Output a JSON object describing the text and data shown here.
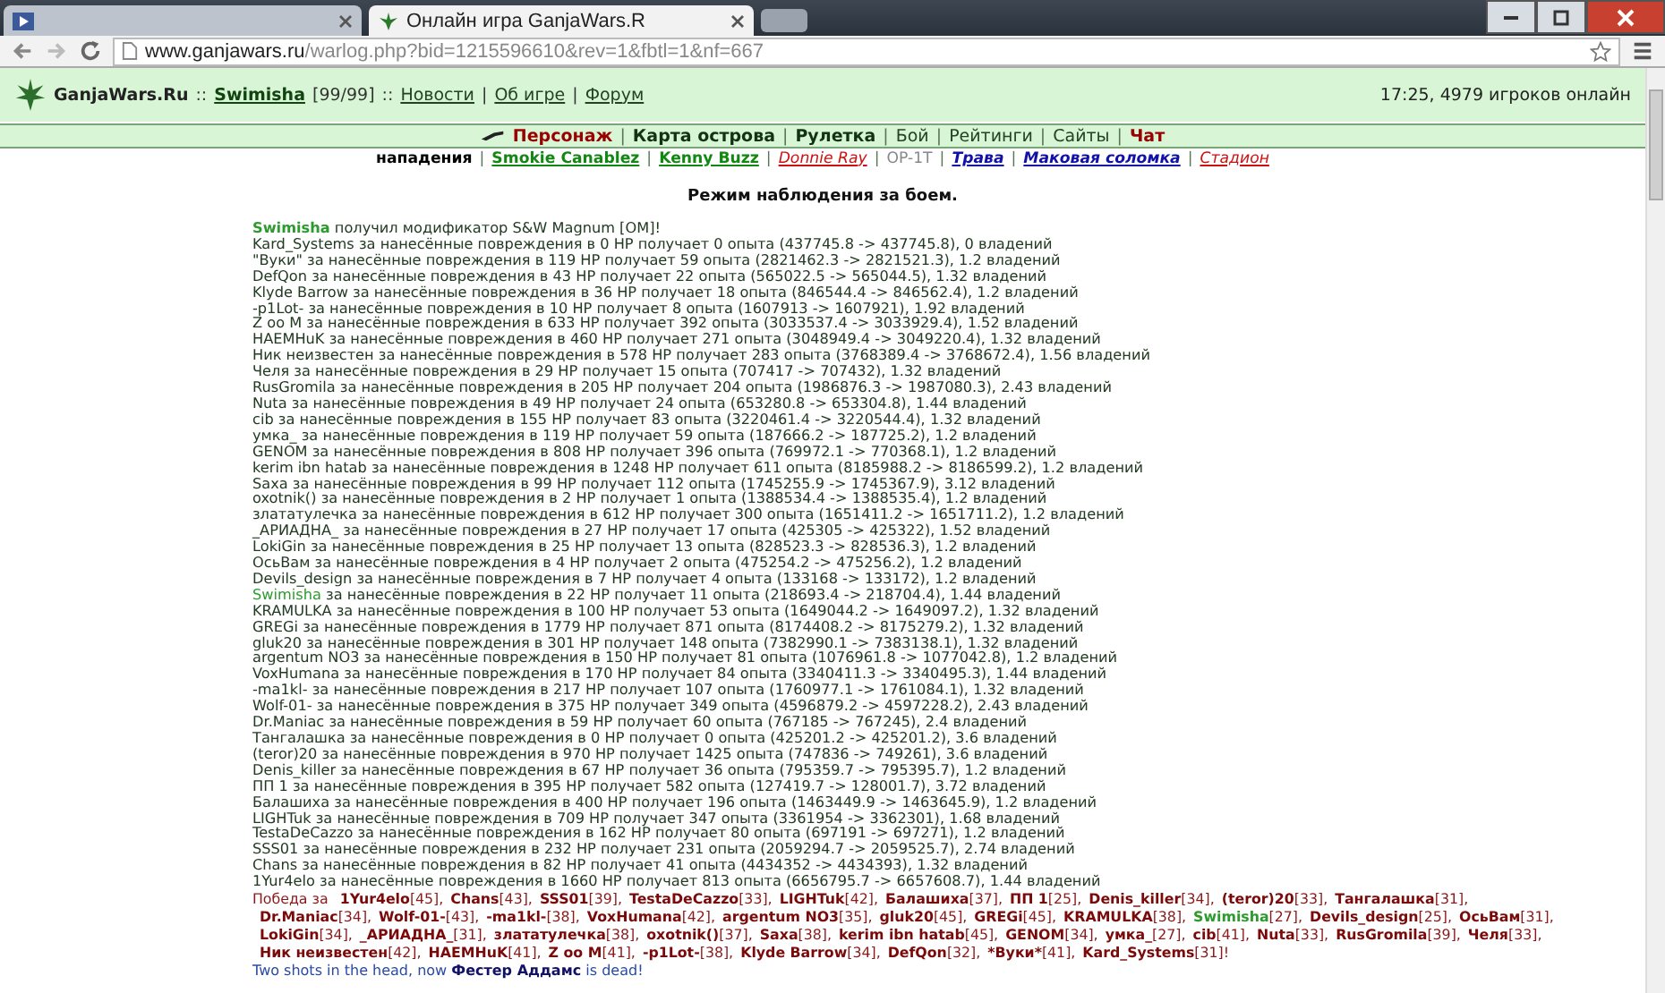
{
  "browser": {
    "tabs": [
      {
        "selected": false
      },
      {
        "title": "Онлайн игра GanjaWars.R",
        "selected": true
      }
    ],
    "url_host": "www.ganjawars.ru",
    "url_path": "/warlog.php?bid=1215596610&rev=1&fbtl=1&nf=667"
  },
  "header": {
    "site": "GanjaWars.Ru",
    "sep": "::",
    "user": "Swimisha",
    "hp": "[99/99]",
    "links": [
      "Новости",
      "Об игре",
      "Форум"
    ],
    "divider": "|",
    "status": "17:25, 4979 игроков онлайн"
  },
  "nav": {
    "divider": "|",
    "items": [
      {
        "label": "Персонаж",
        "kind": "main"
      },
      {
        "label": "Карта острова",
        "kind": "section"
      },
      {
        "label": "Рулетка",
        "kind": "section"
      },
      {
        "label": "Бой",
        "kind": "other"
      },
      {
        "label": "Рейтинги",
        "kind": "other"
      },
      {
        "label": "Сайты",
        "kind": "other"
      },
      {
        "label": "Чат",
        "kind": "main"
      }
    ]
  },
  "subnav": {
    "divider": "|",
    "items": [
      {
        "label": "нападения",
        "color": "#000000",
        "bold": true,
        "italic": false,
        "underline": false
      },
      {
        "label": "Smokie Canablez",
        "color": "#118811",
        "bold": true,
        "italic": false,
        "underline": true
      },
      {
        "label": "Kenny Buzz",
        "color": "#118811",
        "bold": true,
        "italic": false,
        "underline": true
      },
      {
        "label": "Donnie Ray",
        "color": "#cc1111",
        "bold": false,
        "italic": true,
        "underline": true
      },
      {
        "label": "OP-1T",
        "color": "#888888",
        "bold": false,
        "italic": false,
        "underline": false
      },
      {
        "label": "Трава",
        "color": "#1111aa",
        "bold": true,
        "italic": true,
        "underline": true
      },
      {
        "label": "Маковая соломка",
        "color": "#1111aa",
        "bold": true,
        "italic": true,
        "underline": true
      },
      {
        "label": "Стадион",
        "color": "#cc1111",
        "bold": false,
        "italic": true,
        "underline": true
      }
    ]
  },
  "title": "Режим наблюдения за боем.",
  "log": [
    {
      "name": "Swimisha",
      "text": "получил модификатор S&W Magnum [OM]!",
      "self": true,
      "kind": "event"
    },
    {
      "name": "Kard_Systems",
      "text": "за нанесённые повреждения в 0 HP получает 0 опыта (437745.8 -> 437745.8), 0 владений",
      "self": false,
      "kind": "damage"
    },
    {
      "name": "\"Вуки\"",
      "text": "за нанесённые повреждения в 119 HP получает 59 опыта (2821462.3 -> 2821521.3), 1.2 владений",
      "self": false,
      "kind": "damage"
    },
    {
      "name": "DefQon",
      "text": "за нанесённые повреждения в 43 HP получает 22 опыта (565022.5 -> 565044.5), 1.32 владений",
      "self": false,
      "kind": "damage"
    },
    {
      "name": "Klyde Barrow",
      "text": "за нанесённые повреждения в 36 HP получает 18 опыта (846544.4 -> 846562.4), 1.2 владений",
      "self": false,
      "kind": "damage"
    },
    {
      "name": "-p1Lot-",
      "text": "за нанесённые повреждения в 10 HP получает 8 опыта (1607913 -> 1607921), 1.92 владений",
      "self": false,
      "kind": "damage"
    },
    {
      "name": "Z oo M",
      "text": "за нанесённые повреждения в 633 HP получает 392 опыта (3033537.4 -> 3033929.4), 1.52 владений",
      "self": false,
      "kind": "damage"
    },
    {
      "name": "HAEMHuK",
      "text": "за нанесённые повреждения в 460 HP получает 271 опыта (3048949.4 -> 3049220.4), 1.32 владений",
      "self": false,
      "kind": "damage"
    },
    {
      "name": "Ник неизвестен",
      "text": "за нанесённые повреждения в 578 HP получает 283 опыта (3768389.4 -> 3768672.4), 1.56 владений",
      "self": false,
      "kind": "damage"
    },
    {
      "name": "Челя",
      "text": "за нанесённые повреждения в 29 HP получает 15 опыта (707417 -> 707432), 1.32 владений",
      "self": false,
      "kind": "damage"
    },
    {
      "name": "RusGromila",
      "text": "за нанесённые повреждения в 205 HP получает 204 опыта (1986876.3 -> 1987080.3), 2.43 владений",
      "self": false,
      "kind": "damage"
    },
    {
      "name": "Nuta",
      "text": "за нанесённые повреждения в 49 HP получает 24 опыта (653280.8 -> 653304.8), 1.44 владений",
      "self": false,
      "kind": "damage"
    },
    {
      "name": "cib",
      "text": "за нанесённые повреждения в 155 HP получает 83 опыта (3220461.4 -> 3220544.4), 1.32 владений",
      "self": false,
      "kind": "damage"
    },
    {
      "name": "умка_",
      "text": "за нанесённые повреждения в 119 HP получает 59 опыта (187666.2 -> 187725.2), 1.2 владений",
      "self": false,
      "kind": "damage"
    },
    {
      "name": "GENOM",
      "text": "за нанесённые повреждения в 808 HP получает 396 опыта (769972.1 -> 770368.1), 1.2 владений",
      "self": false,
      "kind": "damage"
    },
    {
      "name": "kerim ibn hatab",
      "text": "за нанесённые повреждения в 1248 HP получает 611 опыта (8185988.2 -> 8186599.2), 1.2 владений",
      "self": false,
      "kind": "damage"
    },
    {
      "name": "Saxa",
      "text": "за нанесённые повреждения в 99 HP получает 112 опыта (1745255.9 -> 1745367.9), 3.12 владений",
      "self": false,
      "kind": "damage"
    },
    {
      "name": "oxotnik()",
      "text": "за нанесённые повреждения в 2 HP получает 1 опыта (1388534.4 -> 1388535.4), 1.2 владений",
      "self": false,
      "kind": "damage"
    },
    {
      "name": "злататулечка",
      "text": "за нанесённые повреждения в 612 HP получает 300 опыта (1651411.2 -> 1651711.2), 1.2 владений",
      "self": false,
      "kind": "damage"
    },
    {
      "name": "_АРИАДНА_",
      "text": "за нанесённые повреждения в 27 HP получает 17 опыта (425305 -> 425322), 1.52 владений",
      "self": false,
      "kind": "damage"
    },
    {
      "name": "LokiGin",
      "text": "за нанесённые повреждения в 25 HP получает 13 опыта (828523.3 -> 828536.3), 1.2 владений",
      "self": false,
      "kind": "damage"
    },
    {
      "name": "ОсьВам",
      "text": "за нанесённые повреждения в 4 HP получает 2 опыта (475254.2 -> 475256.2), 1.2 владений",
      "self": false,
      "kind": "damage"
    },
    {
      "name": "Devils_design",
      "text": "за нанесённые повреждения в 7 HP получает 4 опыта (133168 -> 133172), 1.2 владений",
      "self": false,
      "kind": "damage"
    },
    {
      "name": "Swimisha",
      "text": "за нанесённые повреждения в 22 HP получает 11 опыта (218693.4 -> 218704.4), 1.44 владений",
      "self": true,
      "kind": "damage"
    },
    {
      "name": "KRAMULKA",
      "text": "за нанесённые повреждения в 100 HP получает 53 опыта (1649044.2 -> 1649097.2), 1.32 владений",
      "self": false,
      "kind": "damage"
    },
    {
      "name": "GREGi",
      "text": "за нанесённые повреждения в 1779 HP получает 871 опыта (8174408.2 -> 8175279.2), 1.32 владений",
      "self": false,
      "kind": "damage"
    },
    {
      "name": "gluk20",
      "text": "за нанесённые повреждения в 301 HP получает 148 опыта (7382990.1 -> 7383138.1), 1.32 владений",
      "self": false,
      "kind": "damage"
    },
    {
      "name": "argentum NO3",
      "text": "за нанесённые повреждения в 150 HP получает 81 опыта (1076961.8 -> 1077042.8), 1.2 владений",
      "self": false,
      "kind": "damage"
    },
    {
      "name": "VoxHumana",
      "text": "за нанесённые повреждения в 170 HP получает 84 опыта (3340411.3 -> 3340495.3), 1.44 владений",
      "self": false,
      "kind": "damage"
    },
    {
      "name": "-ma1kl-",
      "text": "за нанесённые повреждения в 217 HP получает 107 опыта (1760977.1 -> 1761084.1), 1.32 владений",
      "self": false,
      "kind": "damage"
    },
    {
      "name": "Wolf-01-",
      "text": "за нанесённые повреждения в 375 HP получает 349 опыта (4596879.2 -> 4597228.2), 2.43 владений",
      "self": false,
      "kind": "damage"
    },
    {
      "name": "Dr.Maniac",
      "text": "за нанесённые повреждения в 59 HP получает 60 опыта (767185 -> 767245), 2.4 владений",
      "self": false,
      "kind": "damage"
    },
    {
      "name": "Тангалашка",
      "text": "за нанесённые повреждения в 0 HP получает 0 опыта (425201.2 -> 425201.2), 3.6 владений",
      "self": false,
      "kind": "damage"
    },
    {
      "name": "(teror)20",
      "text": "за нанесённые повреждения в 970 HP получает 1425 опыта (747836 -> 749261), 3.6 владений",
      "self": false,
      "kind": "damage"
    },
    {
      "name": "Denis_killer",
      "text": "за нанесённые повреждения в 67 HP получает 36 опыта (795359.7 -> 795395.7), 1.2 владений",
      "self": false,
      "kind": "damage"
    },
    {
      "name": "ПП 1",
      "text": "за нанесённые повреждения в 395 HP получает 582 опыта (127419.7 -> 128001.7), 3.72 владений",
      "self": false,
      "kind": "damage"
    },
    {
      "name": "Балашиха",
      "text": "за нанесённые повреждения в 400 HP получает 196 опыта (1463449.9 -> 1463645.9), 1.2 владений",
      "self": false,
      "kind": "damage"
    },
    {
      "name": "LIGHTuk",
      "text": "за нанесённые повреждения в 709 HP получает 347 опыта (3361954 -> 3362301), 1.68 владений",
      "self": false,
      "kind": "damage"
    },
    {
      "name": "TestaDeCazzo",
      "text": "за нанесённые повреждения в 162 HP получает 80 опыта (697191 -> 697271), 1.2 владений",
      "self": false,
      "kind": "damage"
    },
    {
      "name": "SSS01",
      "text": "за нанесённые повреждения в 232 HP получает 231 опыта (2059294.7 -> 2059525.7), 2.74 владений",
      "self": false,
      "kind": "damage"
    },
    {
      "name": "Chans",
      "text": "за нанесённые повреждения в 82 HP получает 41 опыта (4434352 -> 4434393), 1.32 владений",
      "self": false,
      "kind": "damage"
    },
    {
      "name": "1Yur4elo",
      "text": "за нанесённые повреждения в 1660 HP получает 813 опыта (6656795.7 -> 6657608.7), 1.44 владений",
      "self": false,
      "kind": "damage"
    }
  ],
  "victory": {
    "prefix": "Победа за",
    "winners": [
      {
        "name": "1Yur4elo",
        "tail": "[45],",
        "self": false
      },
      {
        "name": "Chans",
        "tail": "[43],",
        "self": false
      },
      {
        "name": "SSS01",
        "tail": "[39],",
        "self": false
      },
      {
        "name": "TestaDeCazzo",
        "tail": "[33],",
        "self": false
      },
      {
        "name": "LIGHTuk",
        "tail": "[42],",
        "self": false
      },
      {
        "name": "Балашиха",
        "tail": "[37],",
        "self": false
      },
      {
        "name": "ПП 1",
        "tail": "[25],",
        "self": false
      },
      {
        "name": "Denis_killer",
        "tail": "[34],",
        "self": false
      },
      {
        "name": "(teror)20",
        "tail": "[33],",
        "self": false
      },
      {
        "name": "Тангалашка",
        "tail": "[31],",
        "self": false
      },
      {
        "name": "Dr.Maniac",
        "tail": "[34],",
        "self": false
      },
      {
        "name": "Wolf-01-",
        "tail": "[43],",
        "self": false
      },
      {
        "name": "-ma1kl-",
        "tail": "[38],",
        "self": false
      },
      {
        "name": "VoxHumana",
        "tail": "[42],",
        "self": false
      },
      {
        "name": "argentum NO3",
        "tail": "[35],",
        "self": false
      },
      {
        "name": "gluk20",
        "tail": "[45],",
        "self": false
      },
      {
        "name": "GREGi",
        "tail": "[45],",
        "self": false
      },
      {
        "name": "KRAMULKA",
        "tail": "[38],",
        "self": false
      },
      {
        "name": "Swimisha",
        "tail": "[27],",
        "self": true
      },
      {
        "name": "Devils_design",
        "tail": "[25],",
        "self": false
      },
      {
        "name": "ОсьВам",
        "tail": "[31],",
        "self": false
      },
      {
        "name": "LokiGin",
        "tail": "[34],",
        "self": false
      },
      {
        "name": "_АРИАДНА_",
        "tail": "[31],",
        "self": false
      },
      {
        "name": "злататулечка",
        "tail": "[38],",
        "self": false
      },
      {
        "name": "oxotnik()",
        "tail": "[37],",
        "self": false
      },
      {
        "name": "Saxa",
        "tail": "[38],",
        "self": false
      },
      {
        "name": "kerim ibn hatab",
        "tail": "[45],",
        "self": false
      },
      {
        "name": "GENOM",
        "tail": "[34],",
        "self": false
      },
      {
        "name": "умка_",
        "tail": "[27],",
        "self": false
      },
      {
        "name": "cib",
        "tail": "[41],",
        "self": false
      },
      {
        "name": "Nuta",
        "tail": "[33],",
        "self": false
      },
      {
        "name": "RusGromila",
        "tail": "[39],",
        "self": false
      },
      {
        "name": "Челя",
        "tail": "[33],",
        "self": false
      },
      {
        "name": "Ник неизвестен",
        "tail": "[42],",
        "self": false
      },
      {
        "name": "HAEMHuK",
        "tail": "[41],",
        "self": false
      },
      {
        "name": "Z oo M",
        "tail": "[41],",
        "self": false
      },
      {
        "name": "-p1Lot-",
        "tail": "[38],",
        "self": false
      },
      {
        "name": "Klyde Barrow",
        "tail": "[34],",
        "self": false
      },
      {
        "name": "DefQon",
        "tail": "[32],",
        "self": false
      },
      {
        "name": "*Вуки*",
        "tail": "[41],",
        "self": false
      },
      {
        "name": "Kard_Systems",
        "tail": "[31]!",
        "self": false
      }
    ]
  },
  "final": "Two shots in the head, now **Фестер Аддамс** is dead!"
}
